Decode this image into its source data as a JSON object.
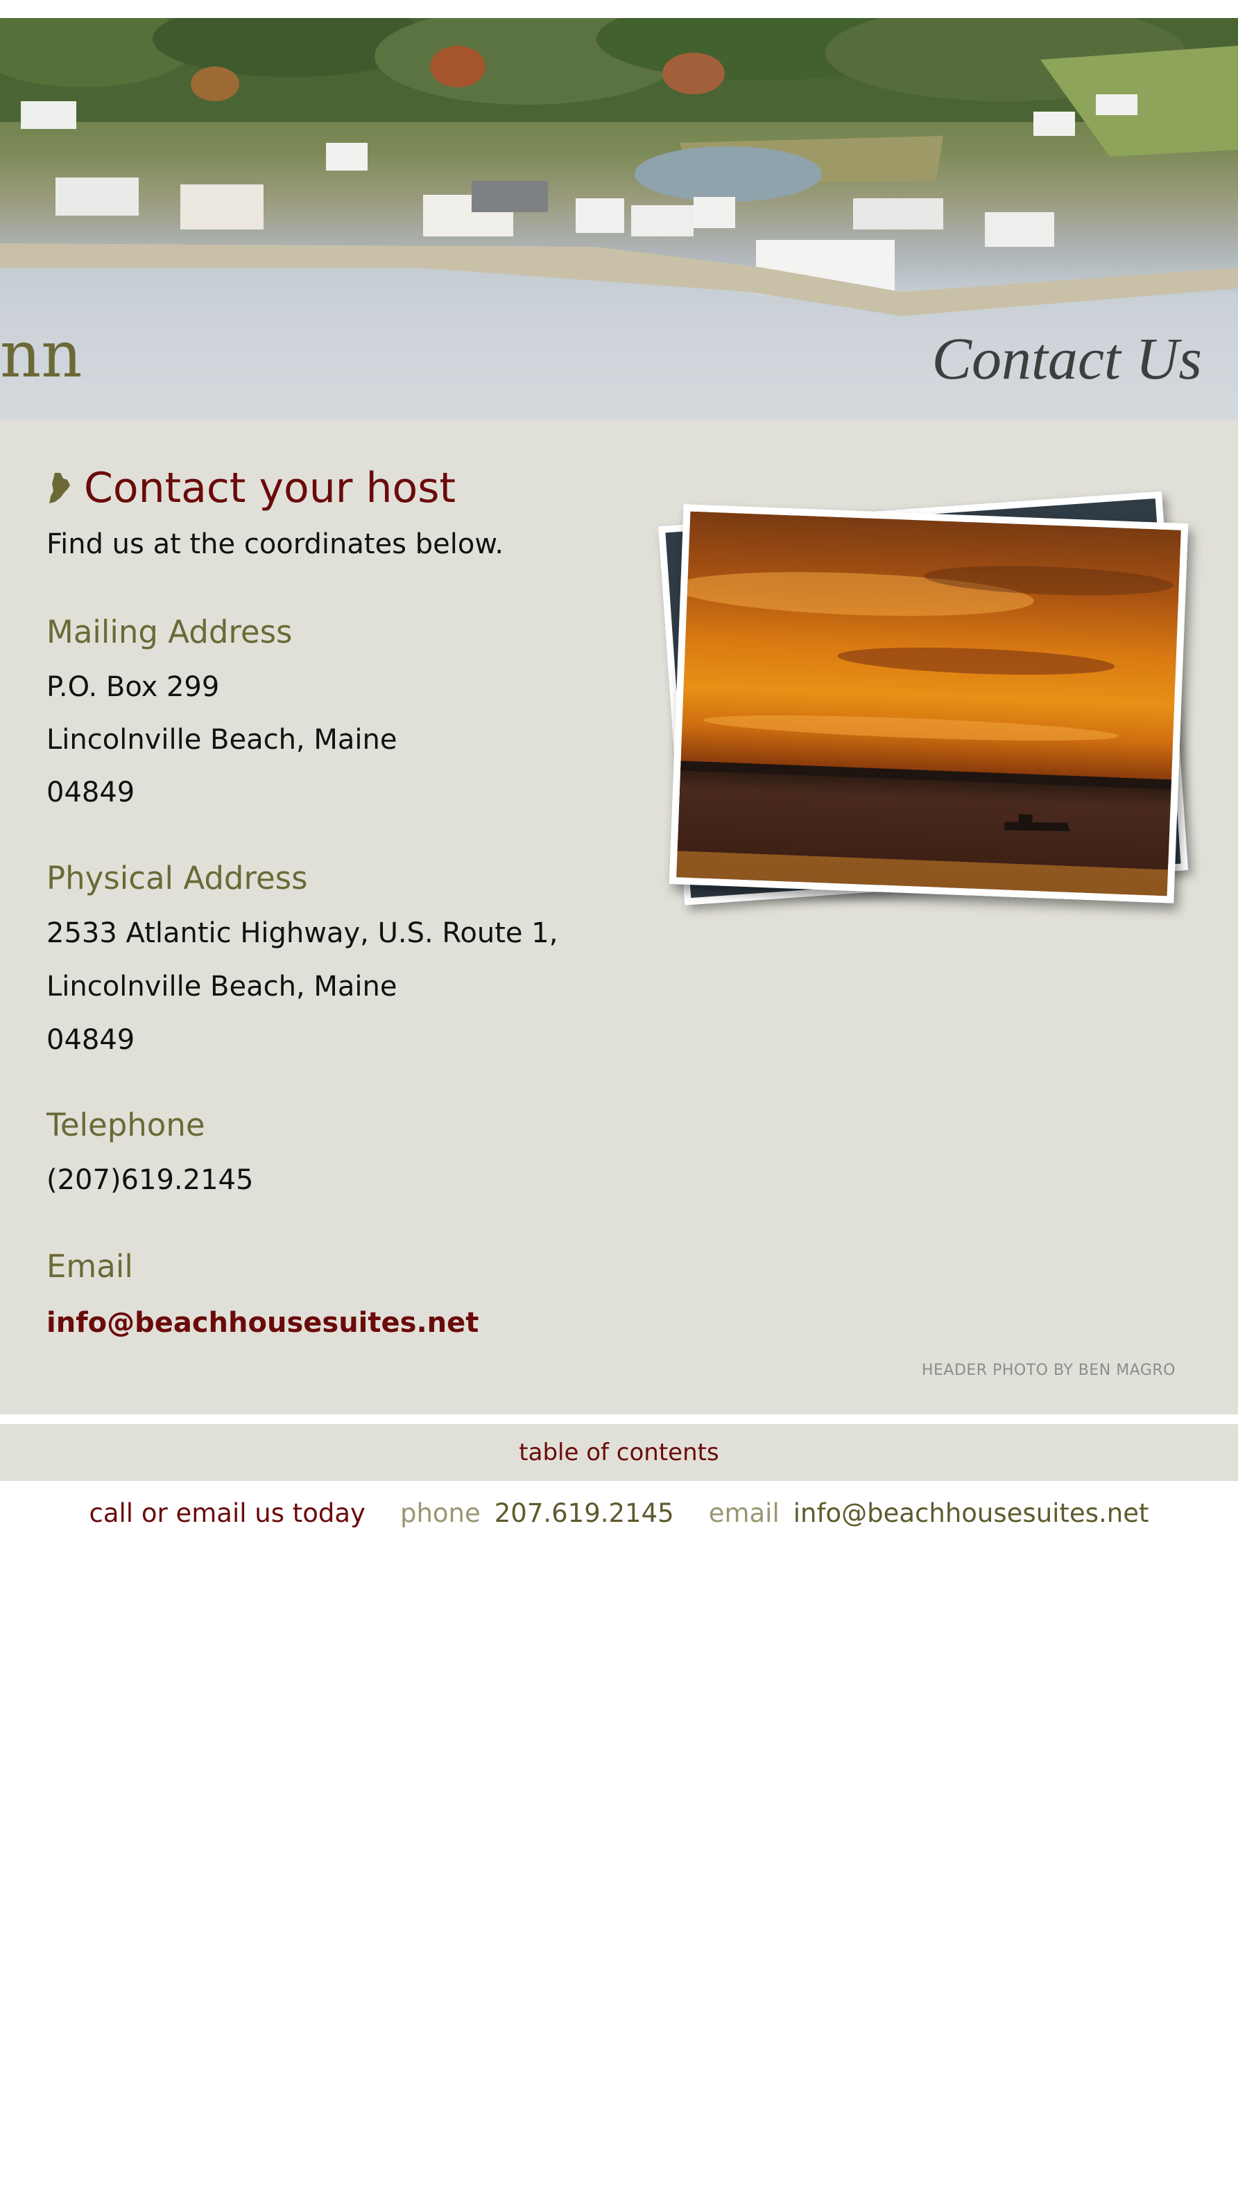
{
  "header": {
    "logo_fragment": "nn",
    "title": "Contact Us"
  },
  "main": {
    "title": "Contact your host",
    "subtitle": "Find us at the coordinates below.",
    "mailing": {
      "heading": "Mailing Address",
      "lines": [
        "P.O. Box 299",
        "Lincolnville Beach, Maine",
        "04849"
      ]
    },
    "physical": {
      "heading": "Physical Address",
      "lines": [
        "2533 Atlantic Highway, U.S. Route 1,",
        "Lincolnville Beach, Maine",
        "04849"
      ]
    },
    "telephone": {
      "heading": "Telephone",
      "number": "(207)619.2145"
    },
    "email": {
      "heading": "Email",
      "address": "info@beachhousesuites.net"
    },
    "photo_credit": "HEADER PHOTO BY BEN MAGRO"
  },
  "footer": {
    "toc_label": "table of contents",
    "cta": "call or email us today",
    "phone_label": "phone",
    "phone": "207.619.2145",
    "email_label": "email",
    "email": "info@beachhousesuites.net"
  },
  "colors": {
    "maroon": "#6a0a0a",
    "olive": "#6b6936",
    "panel": "#e1e0d8"
  }
}
